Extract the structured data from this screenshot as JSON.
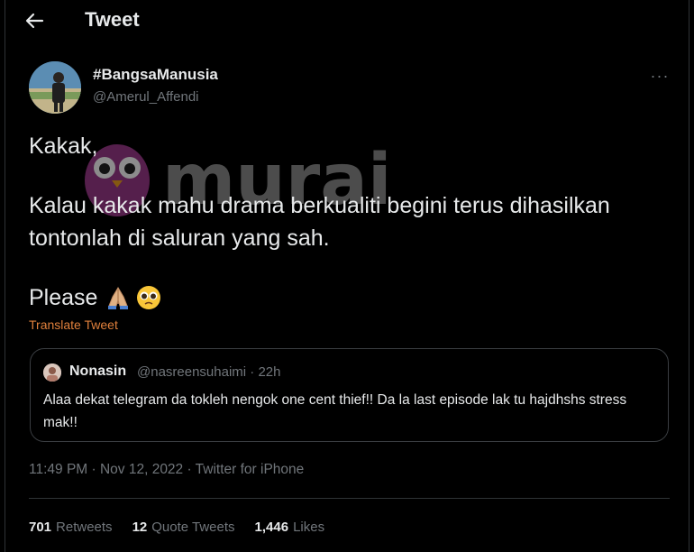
{
  "header": {
    "title": "Tweet"
  },
  "tweet": {
    "author_name": "#BangsaManusia",
    "author_handle": "@Amerul_Affendi",
    "lines": [
      "Kakak,",
      "Kalau kakak mahu drama berkualiti begini terus dihasilkan",
      "tontonlah di saluran yang sah.",
      "Please"
    ],
    "emojis": [
      "folded-hands-emoji",
      "pleading-face-emoji"
    ],
    "translate_label": "Translate Tweet",
    "timestamp": "11:49 PM · Nov 12, 2022 · Twitter for iPhone"
  },
  "quoted_tweet": {
    "author_name": "Nonasin",
    "meta": "@nasreensuhaimi · 22h",
    "text": "Alaa dekat telegram da tokleh nengok one cent thief!! Da la last episode lak tu hajdhshs stress mak!!"
  },
  "stats": {
    "retweets_count": "701",
    "retweets_label": "Retweets",
    "quotes_count": "12",
    "quotes_label": "Quote Tweets",
    "likes_count": "1,446",
    "likes_label": "Likes"
  },
  "watermark": {
    "text": "murai"
  },
  "colors": {
    "background": "#000000",
    "text": "#e7e9ea",
    "secondary": "#71767b",
    "translate_link": "#e0803c",
    "border": "#2f3336"
  }
}
